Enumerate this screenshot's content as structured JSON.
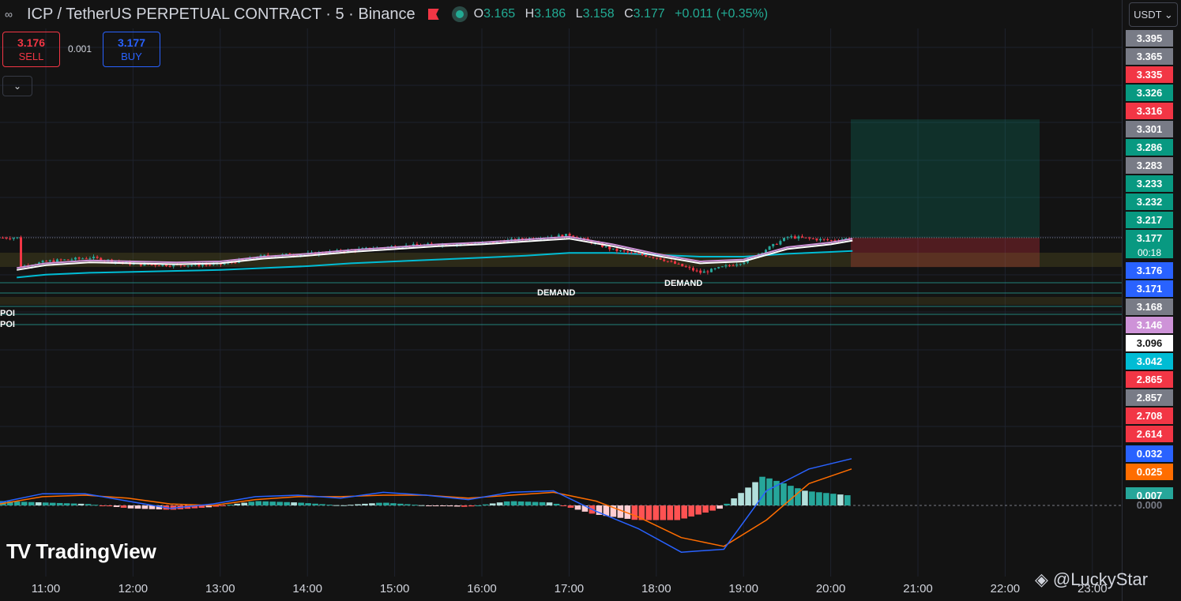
{
  "header": {
    "title": "ICP / TetherUS PERPETUAL CONTRACT · 5 · Binance",
    "ohlc": [
      {
        "k": "O",
        "v": "3.165"
      },
      {
        "k": "H",
        "v": "3.186"
      },
      {
        "k": "L",
        "v": "3.158"
      },
      {
        "k": "C",
        "v": "3.177"
      }
    ],
    "change": "+0.011 (+0.35%)",
    "currency": "USDT ⌄"
  },
  "trade": {
    "sell_price": "3.176",
    "sell_label": "SELL",
    "buy_price": "3.177",
    "buy_label": "BUY",
    "spread": "0.001",
    "collapse_icon": "⌄"
  },
  "price_scale": [
    {
      "label": "3.395",
      "color": "#787b86"
    },
    {
      "label": "3.365",
      "color": "#787b86"
    },
    {
      "label": "3.335",
      "color": "#f23645"
    },
    {
      "label": "3.326",
      "color": "#089981"
    },
    {
      "label": "3.316",
      "color": "#f23645"
    },
    {
      "label": "3.301",
      "color": "#787b86"
    },
    {
      "label": "3.286",
      "color": "#089981"
    },
    {
      "label": "3.283",
      "color": "#787b86"
    },
    {
      "label": "3.233",
      "color": "#089981"
    },
    {
      "label": "3.232",
      "color": "#089981"
    },
    {
      "label": "3.217",
      "color": "#089981"
    },
    {
      "label": "3.177",
      "color": "#089981"
    },
    {
      "label": "3.176",
      "color": "#2962ff"
    },
    {
      "label": "3.171",
      "color": "#2962ff"
    },
    {
      "label": "3.168",
      "color": "#787b86"
    },
    {
      "label": "3.146",
      "color": "#ce93d8"
    },
    {
      "label": "3.096",
      "color": "#ffffff",
      "text": "#131313"
    },
    {
      "label": "3.042",
      "color": "#00bcd4"
    },
    {
      "label": "2.865",
      "color": "#f23645"
    },
    {
      "label": "2.857",
      "color": "#787b86"
    },
    {
      "label": "2.708",
      "color": "#f23645"
    },
    {
      "label": "2.614",
      "color": "#f23645"
    }
  ],
  "countdown": "00:18",
  "macd_scale": [
    {
      "label": "0.032",
      "color": "#2962ff"
    },
    {
      "label": "0.025",
      "color": "#ff6d00"
    },
    {
      "label": "0.007",
      "color": "#26a69a"
    },
    {
      "label": "0.000",
      "color": "#131313",
      "text": "#787b86"
    }
  ],
  "time_axis": [
    "11:00",
    "12:00",
    "13:00",
    "14:00",
    "15:00",
    "16:00",
    "17:00",
    "18:00",
    "19:00",
    "20:00",
    "21:00",
    "22:00",
    "23:00"
  ],
  "annotations": {
    "demand_1": "DEMAND",
    "demand_2": "DEMAND",
    "poi_1": "POI",
    "poi_2": "POI"
  },
  "branding": {
    "logo_text": "TradingView",
    "watermark": "@LuckyStar"
  },
  "colors": {
    "up": "#26a69a",
    "down": "#f23645",
    "ema_fast": "#ffffff",
    "ema_mid": "#ce93d8",
    "ema_slow": "#00bcd4",
    "macd": "#2962ff",
    "signal": "#ff6d00",
    "hist_up": "#26a69a",
    "hist_up_weak": "#b2dfdb",
    "hist_down": "#ff5252",
    "hist_down_weak": "#ffcdd2"
  },
  "chart_data": {
    "type": "candlestick",
    "symbol": "ICPUSDT.P",
    "interval": "5",
    "x_range": [
      "10:40",
      "23:45"
    ],
    "y_range": [
      2.6,
      3.4
    ],
    "close_series": [
      {
        "t": "10:40",
        "v": 3.146
      },
      {
        "t": "11:00",
        "v": 3.152
      },
      {
        "t": "11:30",
        "v": 3.156
      },
      {
        "t": "12:00",
        "v": 3.149
      },
      {
        "t": "12:30",
        "v": 3.148
      },
      {
        "t": "13:00",
        "v": 3.149
      },
      {
        "t": "13:30",
        "v": 3.158
      },
      {
        "t": "14:00",
        "v": 3.16
      },
      {
        "t": "14:30",
        "v": 3.164
      },
      {
        "t": "15:00",
        "v": 3.168
      },
      {
        "t": "15:30",
        "v": 3.17
      },
      {
        "t": "16:00",
        "v": 3.171
      },
      {
        "t": "16:30",
        "v": 3.176
      },
      {
        "t": "17:00",
        "v": 3.18
      },
      {
        "t": "17:30",
        "v": 3.164
      },
      {
        "t": "18:00",
        "v": 3.156
      },
      {
        "t": "18:30",
        "v": 3.14
      },
      {
        "t": "19:00",
        "v": 3.152
      },
      {
        "t": "19:30",
        "v": 3.178
      },
      {
        "t": "20:00",
        "v": 3.174
      },
      {
        "t": "20:15",
        "v": 3.177
      }
    ],
    "ema_fast": [
      3.143,
      3.148,
      3.151,
      3.15,
      3.149,
      3.15,
      3.155,
      3.158,
      3.162,
      3.165,
      3.168,
      3.17,
      3.173,
      3.176,
      3.168,
      3.158,
      3.15,
      3.152,
      3.165,
      3.17,
      3.174
    ],
    "ema_slow": [
      3.135,
      3.138,
      3.14,
      3.141,
      3.142,
      3.143,
      3.145,
      3.147,
      3.15,
      3.152,
      3.154,
      3.156,
      3.158,
      3.161,
      3.161,
      3.159,
      3.157,
      3.157,
      3.16,
      3.162,
      3.163
    ],
    "macd": [
      0.002,
      0.008,
      0.008,
      0.003,
      -0.002,
      0.001,
      0.006,
      0.007,
      0.005,
      0.009,
      0.007,
      0.004,
      0.009,
      0.01,
      -0.004,
      -0.016,
      -0.032,
      -0.03,
      0.01,
      0.025,
      0.032
    ],
    "signal": [
      0.001,
      0.006,
      0.007,
      0.005,
      0.001,
      0.0,
      0.004,
      0.006,
      0.006,
      0.007,
      0.007,
      0.005,
      0.007,
      0.009,
      0.003,
      -0.008,
      -0.022,
      -0.028,
      -0.01,
      0.015,
      0.025
    ],
    "histogram": [
      0.003,
      0.002,
      0.001,
      -0.002,
      -0.003,
      -0.001,
      0.003,
      0.002,
      0.0,
      0.002,
      0.0,
      -0.001,
      0.003,
      0.002,
      -0.006,
      -0.01,
      -0.01,
      -0.002,
      0.02,
      0.01,
      0.007
    ],
    "position": {
      "entry": 3.177,
      "take_profit": 3.301,
      "stop_loss": 3.146
    }
  }
}
